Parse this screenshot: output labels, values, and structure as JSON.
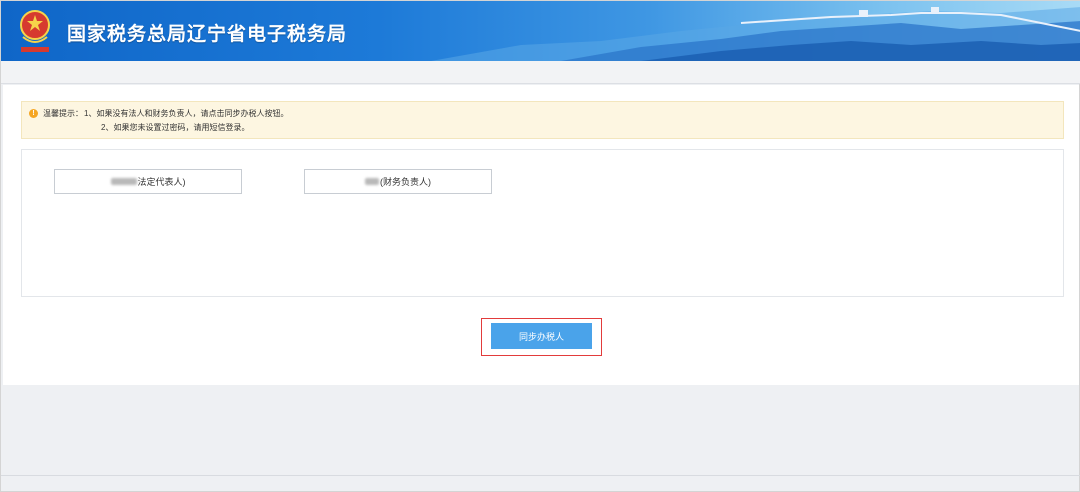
{
  "header": {
    "site_title": "国家税务总局辽宁省电子税务局",
    "emblem_icon": "tax-bureau-emblem-icon",
    "colors": {
      "header_start": "#0f66c8",
      "header_end": "#a9dbf6"
    }
  },
  "notice": {
    "icon": "warning-dot-icon",
    "label": "温馨提示：",
    "line1": "1、如果没有法人和财务负责人，请点击同步办税人按钮。",
    "line2": "2、如果您未设置过密码，请用短信登录。",
    "colors": {
      "background": "#fdf6e1",
      "icon": "#f5a623"
    }
  },
  "people": [
    {
      "role_label": "法定代表人)"
    },
    {
      "role_label": "(财务负责人)"
    }
  ],
  "actions": {
    "sync_label": "同步办税人",
    "colors": {
      "button": "#4aa3ea",
      "highlight": "#e23b3b"
    }
  }
}
